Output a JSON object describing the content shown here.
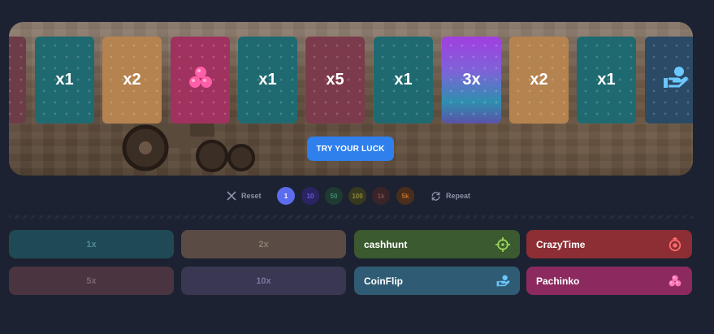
{
  "cards": [
    {
      "label": "",
      "color": "#6e3b48",
      "icon": ""
    },
    {
      "label": "x1",
      "color": "#1f6a70",
      "icon": ""
    },
    {
      "label": "x2",
      "color": "#b5834f",
      "icon": ""
    },
    {
      "label": "",
      "color": "#a0325f",
      "icon": "pachinko-balls-icon"
    },
    {
      "label": "x1",
      "color": "#1f6a70",
      "icon": ""
    },
    {
      "label": "x5",
      "color": "#7c3b4c",
      "icon": ""
    },
    {
      "label": "x1",
      "color": "#1f6a70",
      "icon": ""
    },
    {
      "label": "3x",
      "color": "#9b3fd6",
      "icon": ""
    },
    {
      "label": "x2",
      "color": "#b5834f",
      "icon": ""
    },
    {
      "label": "x1",
      "color": "#1f6a70",
      "icon": ""
    },
    {
      "label": "",
      "color": "#2a4a66",
      "icon": "coinflip-hand-icon"
    }
  ],
  "try_button": "TRY YOUR LUCK",
  "controls": {
    "reset": "Reset",
    "repeat": "Repeat",
    "chips": [
      {
        "label": "1",
        "bg": "#5c6cf0",
        "fg": "#ffffff"
      },
      {
        "label": "10",
        "bg": "#2b2463",
        "fg": "#6c5bd6"
      },
      {
        "label": "50",
        "bg": "#1f3a33",
        "fg": "#3f8a6a"
      },
      {
        "label": "100",
        "bg": "#37391f",
        "fg": "#8b8a3a"
      },
      {
        "label": "1k",
        "bg": "#3a2428",
        "fg": "#7a4a4a"
      },
      {
        "label": "5k",
        "bg": "#4a2e1c",
        "fg": "#c0702f"
      }
    ]
  },
  "bets": {
    "multipliers": [
      {
        "label": "1x",
        "bg": "#1f4a55",
        "fg": "#4f8b96"
      },
      {
        "label": "2x",
        "bg": "#5a4b45",
        "fg": "#8c7c72"
      },
      {
        "label": "5x",
        "bg": "#4a3440",
        "fg": "#7d6570"
      },
      {
        "label": "10x",
        "bg": "#393751",
        "fg": "#7a78a0"
      }
    ],
    "games": [
      {
        "label": "cashhunt",
        "bg": "#3b5a2f",
        "icon": "crosshair-icon",
        "icon_color": "#9bd35a"
      },
      {
        "label": "CrazyTime",
        "bg": "#8c2e34",
        "icon": "crazytime-wheel-icon",
        "icon_color": "#ff6b6b"
      },
      {
        "label": "CoinFlip",
        "bg": "#2f5c74",
        "icon": "coinflip-hand-icon",
        "icon_color": "#6cc7ff"
      },
      {
        "label": "Pachinko",
        "bg": "#8c2a60",
        "icon": "pachinko-balls-icon",
        "icon_color": "#ff7ab8"
      }
    ]
  }
}
